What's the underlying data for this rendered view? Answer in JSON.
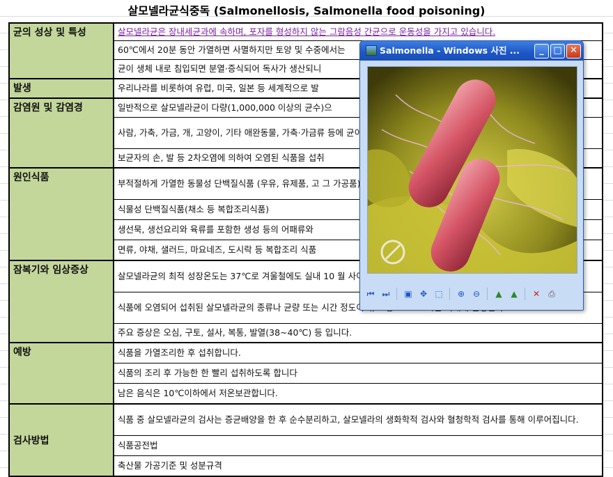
{
  "title": "살모넬라균식중독 (Salmonellosis, Salmonella food poisoning)",
  "sections": [
    {
      "category": "균의 성상 및 특성",
      "rows": [
        "살모넬라균은 장내세균과에 속하며, 포자를 형성하지 않는 그람음성 간균으로 운동성을 가지고 있습니다.",
        "60℃에서 20분 동안 가열하면 사멸하지만 토양 및 수중에서는",
        "균이 생체 내로 침입되면 분열·증식되어 독사가 생산되니"
      ]
    },
    {
      "category": "발생",
      "rows": [
        "우리나라를 비롯하여 유럽, 미국, 일본 등 세계적으로 발"
      ]
    },
    {
      "category": "감염원 및 감염경",
      "rows": [
        "일반적으로 살모넬라균이 다량(1,000,000 이상의 균수)으",
        "사람, 가축, 가금, 개, 고양이, 기타 애완동물, 가축·가금류 등에 균이 존재합니다",
        "보균자의 손, 발 등 2차오염에 의하여 오염된 식품을 섭취"
      ]
    },
    {
      "category": "원인식품",
      "rows": [
        "부적절하게 가열한 동물성 단백질식품 (우유, 유제품, 고 그 가공품)",
        "식물성 단백질식품(채소 등 복합조리식품)",
        "생선묵, 생선요리와 육류를 포함한 생성 등의 어패류와",
        "면류, 야채, 샐러드, 마요네즈, 도시락 등 복합조리 식품"
      ]
    },
    {
      "category": "잠복기와 임상증상",
      "rows": [
        "살모넬라균의 최적 성장온도는 37℃로 겨울철에도 실내 10 월 사이에 발생한다.",
        "식품에 오염되어 섭취된 살모넬라균의 종류나 균량 또는 시간 정도이며, 보통 12~24시간 이내에 발병한다.",
        "주요 증상은 오심, 구토, 설사, 복통, 발열(38~40℃) 등 입니다."
      ]
    },
    {
      "category": "예방",
      "rows": [
        "식품을 가열조리한 후 섭취합니다.",
        "식품의 조리 후 가능한 한 빨리 섭취하도록 합니다",
        "남은 음식은 10℃이하에서 저온보관합니다."
      ]
    },
    {
      "category": "검사방법",
      "rows": [
        "식품 중 살모넬라균의 검사는 증균배양을 한 후 순수분리하고, 살모넬라의 생화학적 검사와 혈청학적 검사를 통해 이루어집니다.",
        "식품공전법",
        "축산물 가공기준 및 성분규격"
      ]
    }
  ],
  "viewer": {
    "window_title": "Salmonella - Windows 사진 ...",
    "buttons": {
      "minimize": "_",
      "maximize": "□",
      "close": "✕"
    },
    "toolbar": [
      "previous-icon",
      "next-icon",
      "actual-size-icon",
      "slideshow-icon",
      "delete-icon",
      "zoom-in-icon",
      "zoom-out-icon",
      "rotate-ccw-icon",
      "rotate-cw-icon",
      "close-x-icon",
      "print-icon"
    ]
  }
}
